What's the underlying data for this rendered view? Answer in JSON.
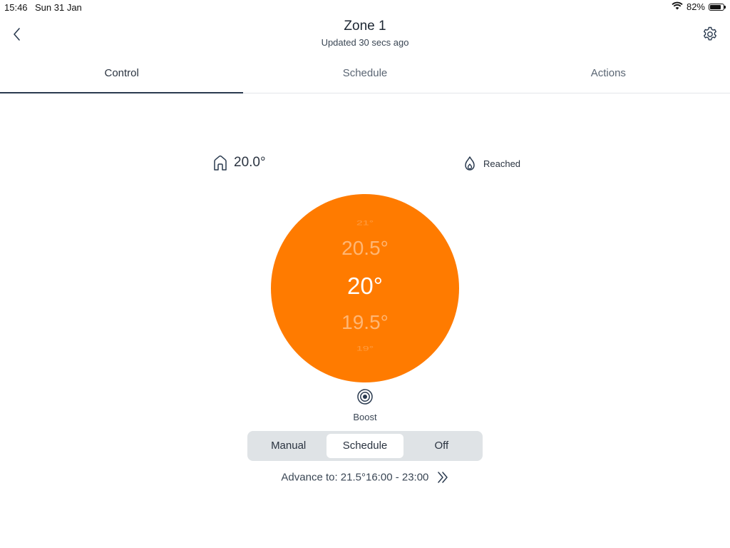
{
  "status_bar": {
    "time": "15:46",
    "date": "Sun 31 Jan",
    "battery_percent": "82%",
    "battery_level": 0.82
  },
  "header": {
    "title": "Zone 1",
    "subtitle": "Updated 30 secs ago",
    "back_icon": "chevron-left-icon",
    "settings_icon": "gear-icon"
  },
  "tabs": [
    {
      "label": "Control",
      "active": true
    },
    {
      "label": "Schedule",
      "active": false
    },
    {
      "label": "Actions",
      "active": false
    }
  ],
  "current_temperature": "20.0°",
  "heating_status": "Reached",
  "dial": {
    "color": "#ff7b00",
    "options": [
      "21°",
      "20.5°",
      "20°",
      "19.5°",
      "19°"
    ],
    "selected": "20°"
  },
  "boost": {
    "label": "Boost",
    "icon": "boost-target-icon"
  },
  "modes": [
    {
      "label": "Manual",
      "active": false
    },
    {
      "label": "Schedule",
      "active": true
    },
    {
      "label": "Off",
      "active": false
    }
  ],
  "advance": {
    "label": "Advance to: 21.5°16:00 - 23:00",
    "icon": "double-chevron-right-icon"
  },
  "colors": {
    "accent": "#ff7b00",
    "text": "#2a3340",
    "segment_bg": "#dfe3e6"
  }
}
